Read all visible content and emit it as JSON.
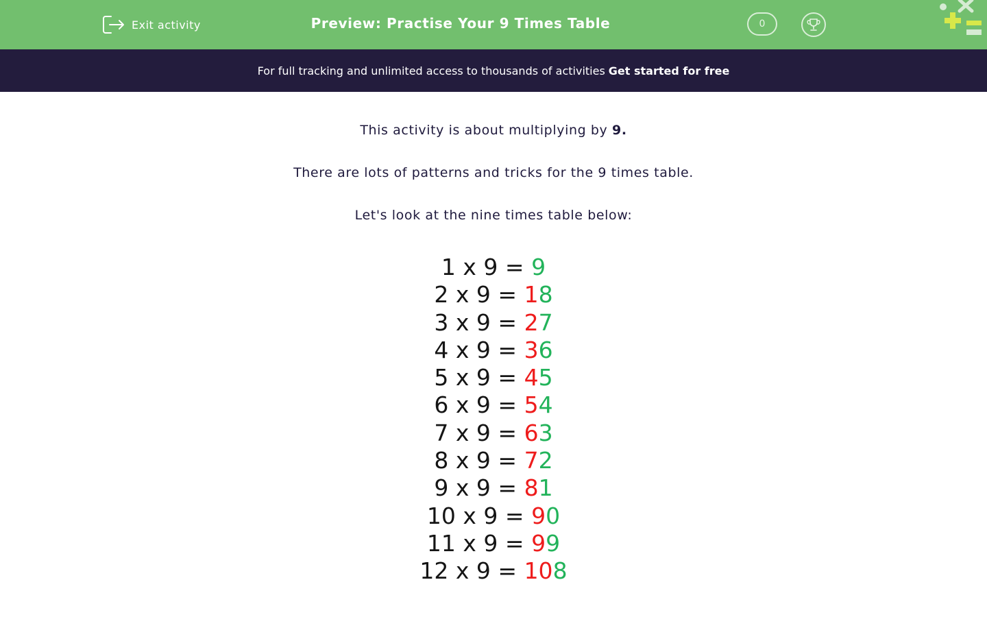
{
  "header": {
    "exit_label": "Exit activity",
    "title": "Preview: Practise Your 9 Times Table",
    "score": "0",
    "bg_color": "#72bf6e"
  },
  "banner": {
    "text": "For full tracking and unlimited access to thousands of activities",
    "link": "Get started for free",
    "bg_color": "#231c3d"
  },
  "content": {
    "intro_prefix": "This activity is about multiplying by ",
    "intro_bold": "9.",
    "line2": "There are lots of patterns and tricks for the 9 times table.",
    "line3": "Let's look at the nine times table below:"
  },
  "times_table": {
    "tens_color": "#ee1c1c",
    "ones_color": "#22b35a",
    "rows": [
      {
        "lhs": "1 x 9 = ",
        "tens": "",
        "ones": "9"
      },
      {
        "lhs": "2 x 9 = ",
        "tens": "1",
        "ones": "8"
      },
      {
        "lhs": "3 x 9 = ",
        "tens": "2",
        "ones": "7"
      },
      {
        "lhs": "4 x 9 = ",
        "tens": "3",
        "ones": "6"
      },
      {
        "lhs": "5 x 9 = ",
        "tens": "4",
        "ones": "5"
      },
      {
        "lhs": "6 x 9 = ",
        "tens": "5",
        "ones": "4"
      },
      {
        "lhs": "7 x 9 = ",
        "tens": "6",
        "ones": "3"
      },
      {
        "lhs": "8 x 9 = ",
        "tens": "7",
        "ones": "2"
      },
      {
        "lhs": "9 x 9 = ",
        "tens": "8",
        "ones": "1"
      },
      {
        "lhs": "10 x 9 = ",
        "tens": "9",
        "ones": "0"
      },
      {
        "lhs": "11 x 9 = ",
        "tens": "9",
        "ones": "9"
      },
      {
        "lhs": "12 x 9 = ",
        "tens": "10",
        "ones": "8"
      }
    ]
  }
}
